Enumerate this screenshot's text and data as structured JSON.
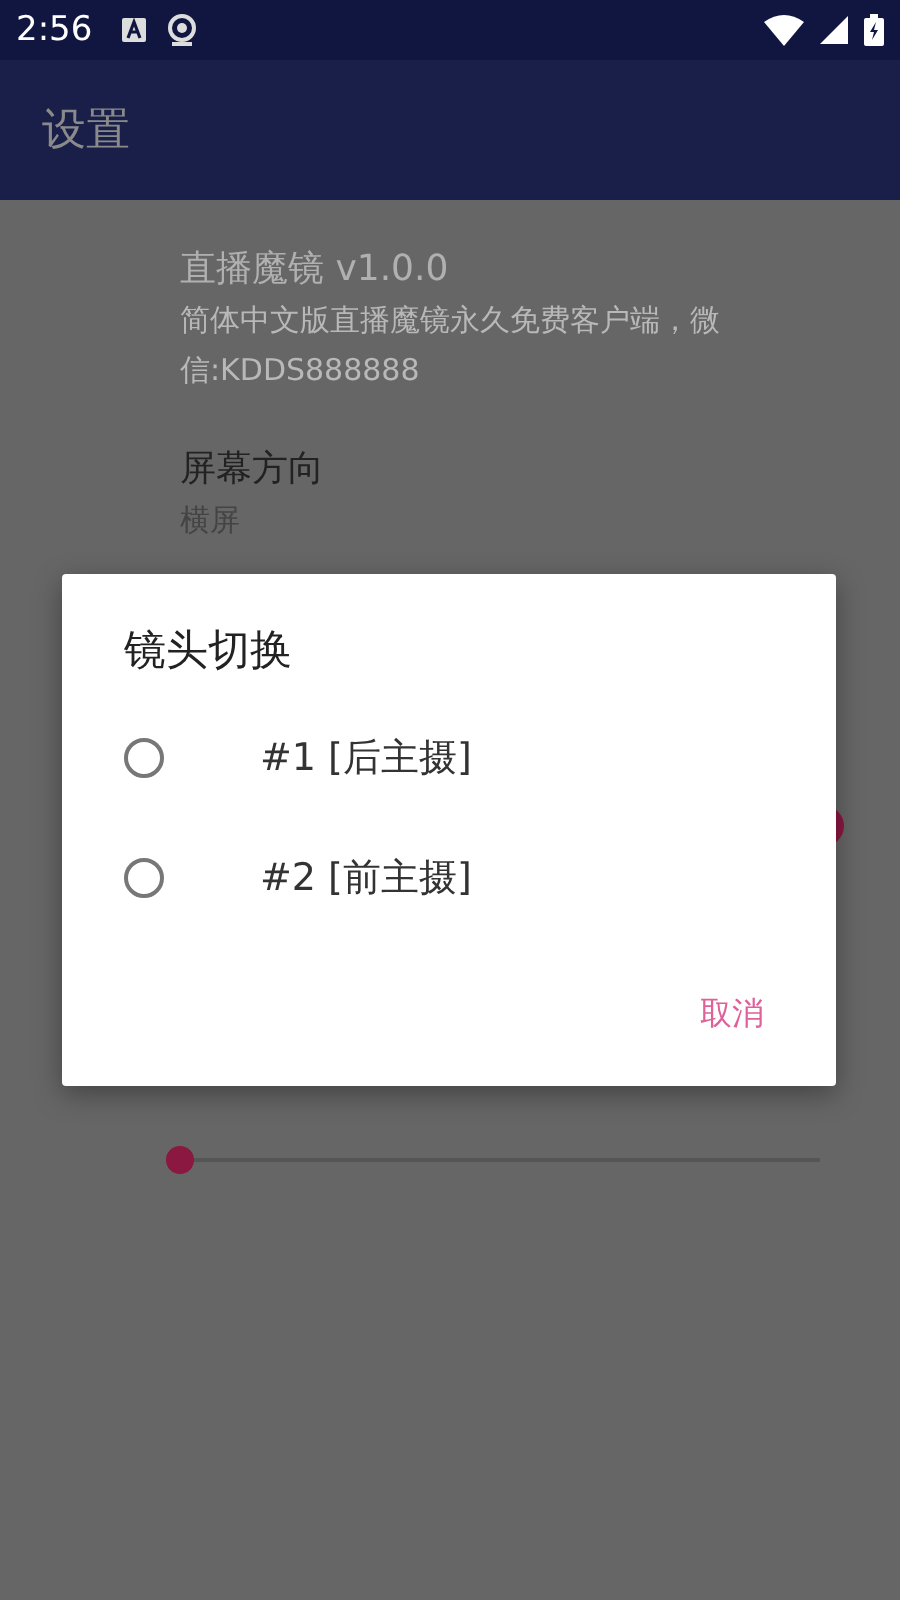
{
  "status_bar": {
    "time": "2:56"
  },
  "app_bar": {
    "title": "设置"
  },
  "settings": [
    {
      "kind": "info",
      "title": "直播魔镜 v1.0.0",
      "summary": "简体中文版直播魔镜永久免费客户端，微信:KDDS888888"
    },
    {
      "kind": "info",
      "title": "屏幕方向",
      "summary": "横屏"
    },
    {
      "kind": "switch",
      "on": true
    },
    {
      "kind": "slider",
      "level": 0
    }
  ],
  "dialog": {
    "title": "镜头切换",
    "options": [
      {
        "label": "#1 [后主摄]",
        "selected": false
      },
      {
        "label": "#2 [前主摄]",
        "selected": false
      }
    ],
    "buttons": [
      "取消"
    ]
  }
}
